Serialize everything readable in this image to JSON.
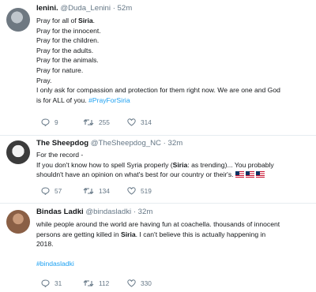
{
  "tweets": [
    {
      "name": "lenini.",
      "handle": "@Duda_Lenini",
      "time": "· 52m",
      "lines": [
        {
          "pre": "Pray for all of ",
          "hl": "Siria",
          "post": "."
        },
        {
          "pre": "Pray for the innocent."
        },
        {
          "pre": "Pray for the children."
        },
        {
          "pre": "Pray for the adults."
        },
        {
          "pre": "Pray for the animals."
        },
        {
          "pre": "Pray for nature."
        },
        {
          "pre": "Pray."
        },
        {
          "pre": "I only ask for compassion and protection for them right now. We are one and God"
        },
        {
          "pre": "is for ALL of you. ",
          "tag": "#PrayForSiria"
        }
      ],
      "replies": "9",
      "retweets": "255",
      "likes": "314"
    },
    {
      "name": "The Sheepdog",
      "handle": "@TheSheepdog_NC",
      "time": "· 32m",
      "lines": [
        {
          "pre": "For the record -"
        },
        {
          "pre": "If you don't know how to spell Syria properly (",
          "hl": "Siria",
          "post": ": as trending)... You probably"
        },
        {
          "pre": "shouldn't have an opinion on what's best for our country or their's."
        }
      ],
      "flags": 3,
      "replies": "57",
      "retweets": "134",
      "likes": "519"
    },
    {
      "name": "Bindas Ladki",
      "handle": "@bindasladki",
      "time": "· 32m",
      "lines": [
        {
          "pre": "while people around the world are having fun at coachella. thousands of innocent"
        },
        {
          "pre": "persons are getting killed in ",
          "hl": "Siria",
          "post": ". I can't believe this is actually happening in"
        },
        {
          "pre": "2018."
        },
        {
          "pre": ""
        },
        {
          "tag": "#bindasladki"
        }
      ],
      "replies": "31",
      "retweets": "112",
      "likes": "330"
    }
  ],
  "colors": {
    "accent": "#1da1f2",
    "muted": "#657786",
    "text": "#14171a",
    "border": "#e6ecf0"
  },
  "icons": [
    "reply-icon",
    "retweet-icon",
    "like-icon",
    "more-icon"
  ]
}
